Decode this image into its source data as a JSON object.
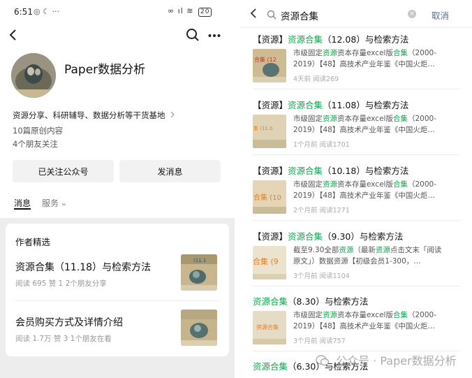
{
  "profile": {
    "status": {
      "time": "6:51",
      "icons": "◎ ☾ ···",
      "right_icons": "∞ ıl ≋",
      "battery": "20"
    },
    "account_name": "Paper数据分析",
    "description": "资源分享、科研辅导、数据分析等干货基地",
    "original_count": "10篇原创内容",
    "friends_following": "4个朋友关注",
    "buttons": {
      "followed": "已关注公众号",
      "message": "发消息"
    },
    "tabs": {
      "messages": "消息",
      "services": "服务"
    },
    "picks": {
      "title": "作者精选",
      "items": [
        {
          "title": "资源合集（11.18）与检索方法",
          "meta": "阅读 695  赞 1  2个朋友分享"
        },
        {
          "title": "会员购买方式及详情介绍",
          "meta": "阅读 1.7万  赞 3  1个朋友在看"
        }
      ]
    }
  },
  "search": {
    "query": "资源合集",
    "cancel": "取消",
    "results": [
      {
        "prefix": "【资源】",
        "keyword": "资源合集",
        "suffix": "（12.08）与检索方法",
        "snippet_a": "市级固定",
        "snippet_hl1": "资源",
        "snippet_b": "资本存量excel版",
        "snippet_hl2": "合集",
        "snippet_c": "（2000-2019）【48】高技术产业年鉴《中国火炬…",
        "meta": "4天前  阅读269",
        "thumb_text": "合集 (12"
      },
      {
        "prefix": "【资源】",
        "keyword": "资源合集",
        "suffix": "（11.08）与检索方法",
        "snippet_a": "市级固定",
        "snippet_hl1": "资源",
        "snippet_b": "资本存量excel版",
        "snippet_hl2": "合集",
        "snippet_c": "（2000-2019）【48】高技术产业年鉴《中国火炬…",
        "meta": "1个月前  阅读1701",
        "thumb_text": "集 (11.0"
      },
      {
        "prefix": "【资源】",
        "keyword": "资源合集",
        "suffix": "（10.18）与检索方法",
        "snippet_a": "市级固定",
        "snippet_hl1": "资源",
        "snippet_b": "资本存量excel版",
        "snippet_hl2": "合集",
        "snippet_c": "（2000-2019）【48】高技术产业年鉴《中国火炬…",
        "meta": "2个月前  阅读1271",
        "thumb_text": "合集 (10"
      },
      {
        "prefix": "【资源】",
        "keyword": "资源合集",
        "suffix": "（9.30）与检索方法",
        "snippet_a": "截至9.30全部",
        "snippet_hl1": "资源",
        "snippet_b": "（最新",
        "snippet_hl2": "资源",
        "snippet_c": "点击文末「阅读原文」）数据资源【初级会员1-300，…",
        "meta": "3个月前  阅读1104",
        "thumb_text": "合集 (9"
      },
      {
        "prefix": "",
        "keyword": "资源合集",
        "suffix": "（8.30）与检索方法",
        "snippet_a": "市级固定",
        "snippet_hl1": "资源",
        "snippet_b": "资本存量excel版",
        "snippet_hl2": "合集",
        "snippet_c": "（2000-2019）【48】高技术产业年鉴《中国火炬…",
        "meta": "3个月前  阅读757",
        "thumb_text": "资源合集"
      },
      {
        "prefix": "",
        "keyword": "资源合集",
        "suffix": "（6.30）与检索方法",
        "snippet_a": "",
        "snippet_hl1": "",
        "snippet_b": "",
        "snippet_hl2": "",
        "snippet_c": "",
        "meta": "",
        "thumb_text": ""
      }
    ]
  },
  "watermark": "公众号 · Paper数据分析",
  "colors": {
    "highlight": "#07a84a",
    "link": "#576b95",
    "background": "#ededed"
  }
}
